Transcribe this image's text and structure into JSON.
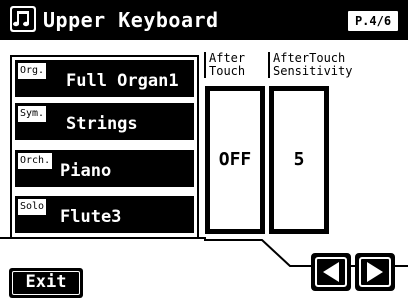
{
  "header": {
    "title": "Upper Keyboard",
    "page": "P.4/6",
    "icon": "music-note-icon"
  },
  "parts": [
    {
      "tag": "Org.",
      "name": "Full Organ1"
    },
    {
      "tag": "Sym.",
      "name": "Strings"
    },
    {
      "tag": "Orch.",
      "name": "Piano"
    },
    {
      "tag": "Solo",
      "name": "Flute3"
    }
  ],
  "columns": {
    "after_touch": {
      "label_line1": "After",
      "label_line2": "Touch",
      "value": "OFF"
    },
    "sensitivity": {
      "label_line1": "AfterTouch",
      "label_line2": "Sensitivity",
      "value": "5"
    }
  },
  "footer": {
    "exit_label": "Exit",
    "prev_icon": "arrow-left-icon",
    "next_icon": "arrow-right-icon"
  }
}
